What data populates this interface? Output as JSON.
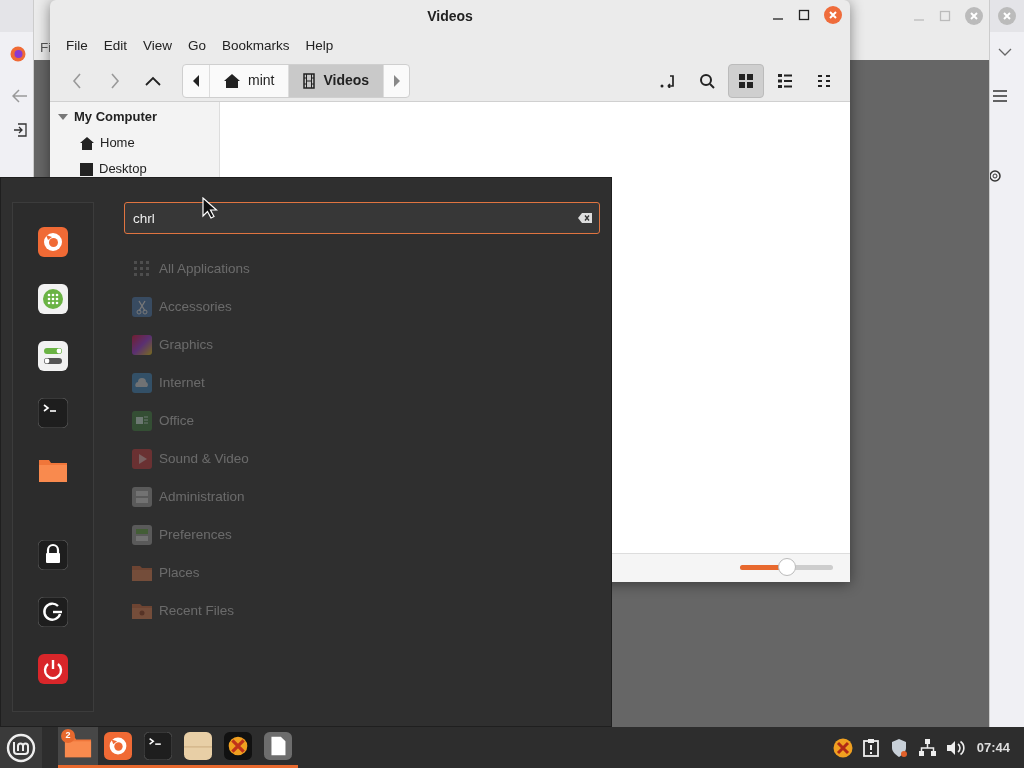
{
  "browser_window": {
    "menu_fragment": "Fi"
  },
  "files_window": {
    "title": "Videos",
    "menu": [
      "File",
      "Edit",
      "View",
      "Go",
      "Bookmarks",
      "Help"
    ],
    "path": [
      {
        "label": "mint",
        "kind": "home",
        "selected": false
      },
      {
        "label": "Videos",
        "kind": "video",
        "selected": true
      }
    ],
    "view_modes": [
      {
        "kind": "icons",
        "selected": true
      },
      {
        "kind": "list",
        "selected": false
      },
      {
        "kind": "compact",
        "selected": false
      }
    ],
    "sidebar": {
      "heading": "My Computer",
      "expanded": true,
      "items": [
        {
          "label": "Home",
          "kind": "home"
        },
        {
          "label": "Desktop",
          "kind": "desktop"
        }
      ]
    },
    "zoom": {
      "level": 0.5
    }
  },
  "app_menu": {
    "search": {
      "value": "chrl"
    },
    "favorites": [
      {
        "kind": "firefox"
      },
      {
        "kind": "software"
      },
      {
        "kind": "settings"
      },
      {
        "kind": "terminal"
      },
      {
        "kind": "folder"
      }
    ],
    "session": [
      {
        "kind": "lock"
      },
      {
        "kind": "logout"
      },
      {
        "kind": "shutdown"
      }
    ],
    "categories": [
      {
        "label": "All Applications",
        "kind": "all",
        "dimmed": true
      },
      {
        "label": "Accessories",
        "kind": "accessories",
        "dimmed": true
      },
      {
        "label": "Graphics",
        "kind": "graphics",
        "dimmed": true
      },
      {
        "label": "Internet",
        "kind": "internet",
        "dimmed": true
      },
      {
        "label": "Office",
        "kind": "office",
        "dimmed": true
      },
      {
        "label": "Sound & Video",
        "kind": "sound",
        "dimmed": true
      },
      {
        "label": "Administration",
        "kind": "admin",
        "dimmed": true
      },
      {
        "label": "Preferences",
        "kind": "prefs",
        "dimmed": true
      },
      {
        "label": "Places",
        "kind": "places",
        "dimmed": true
      },
      {
        "label": "Recent Files",
        "kind": "recent",
        "dimmed": true
      }
    ]
  },
  "taskbar": {
    "apps": [
      {
        "kind": "files",
        "active": true,
        "badge": "2"
      },
      {
        "kind": "firefox",
        "active": false
      },
      {
        "kind": "terminal",
        "active": false
      },
      {
        "kind": "notes",
        "active": false
      },
      {
        "kind": "xapp",
        "active": false
      },
      {
        "kind": "document",
        "active": false
      }
    ],
    "tray": [
      {
        "kind": "xapp"
      },
      {
        "kind": "clipboard"
      },
      {
        "kind": "shield"
      },
      {
        "kind": "network"
      },
      {
        "kind": "volume"
      }
    ],
    "clock": "07:44"
  }
}
